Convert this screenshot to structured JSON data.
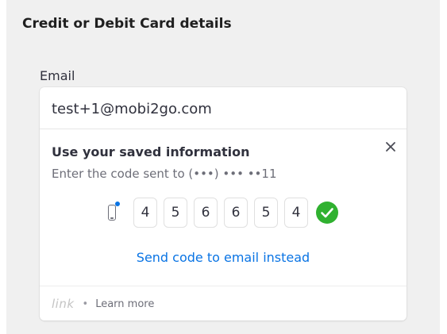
{
  "panel": {
    "title": "Credit or Debit Card details"
  },
  "email": {
    "label": "Email",
    "value": "test+1@mobi2go.com"
  },
  "link_auth": {
    "title": "Use your saved information",
    "subtitle": "Enter the code sent to (•••) ••• ••11",
    "code_digits": [
      "4",
      "5",
      "6",
      "6",
      "5",
      "4"
    ],
    "status": "verified",
    "send_email_label": "Send code to email instead",
    "footer": {
      "logo_text": "link",
      "separator": "•",
      "learn_more_label": "Learn more"
    }
  },
  "icons": {
    "close": "close-icon",
    "phone": "phone-icon",
    "check": "check-circle-icon"
  },
  "colors": {
    "accent_blue": "#0a74e4",
    "success_green": "#30b130",
    "panel_bg": "#f0f0f0"
  }
}
